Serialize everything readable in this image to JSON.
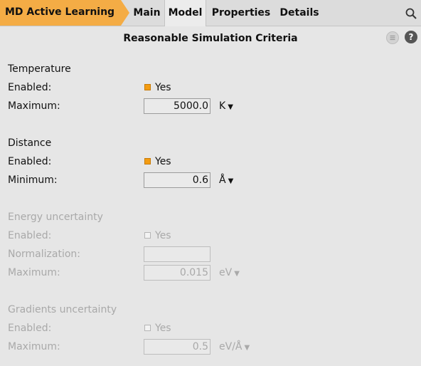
{
  "tabbar": {
    "crumb": "MD Active Learning",
    "tabs": [
      "Main",
      "Model",
      "Properties",
      "Details"
    ],
    "active_tab": "Model",
    "accent": "#f4ac45"
  },
  "panel": {
    "title": "Reasonable Simulation Criteria"
  },
  "sections": {
    "temperature": {
      "heading": "Temperature",
      "enabled_label": "Enabled:",
      "enabled_value": "Yes",
      "enabled": true,
      "max_label": "Maximum:",
      "max_value": "5000.0",
      "max_unit": "K"
    },
    "distance": {
      "heading": "Distance",
      "enabled_label": "Enabled:",
      "enabled_value": "Yes",
      "enabled": true,
      "min_label": "Minimum:",
      "min_value": "0.6",
      "min_unit": "Å"
    },
    "energy": {
      "heading": "Energy uncertainty",
      "enabled_label": "Enabled:",
      "enabled_value": "Yes",
      "enabled": false,
      "norm_label": "Normalization:",
      "norm_value": "",
      "max_label": "Maximum:",
      "max_value": "0.015",
      "max_unit": "eV"
    },
    "gradients": {
      "heading": "Gradients uncertainty",
      "enabled_label": "Enabled:",
      "enabled_value": "Yes",
      "enabled": false,
      "max_label": "Maximum:",
      "max_value": "0.5",
      "max_unit": "eV/Å"
    }
  },
  "icons": {
    "search": "search-icon",
    "menu": "menu-icon",
    "help": "help-icon",
    "dropdown": "chevron-down-icon"
  },
  "colors": {
    "checkbox_on": "#f39c12",
    "disabled_text": "#a9a9a9"
  }
}
